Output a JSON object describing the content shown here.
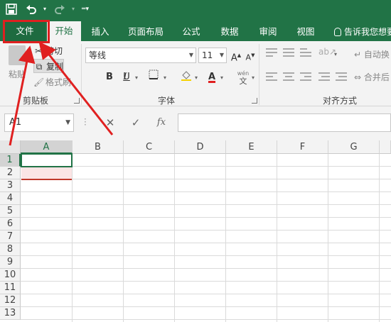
{
  "quick_access": {
    "save_icon": "save-icon",
    "undo_icon": "undo-icon",
    "redo_icon": "redo-icon",
    "customize_icon": "dropdown-icon"
  },
  "tabs": [
    {
      "label": "文件",
      "active": false
    },
    {
      "label": "开始",
      "active": true
    },
    {
      "label": "插入",
      "active": false
    },
    {
      "label": "页面布局",
      "active": false
    },
    {
      "label": "公式",
      "active": false
    },
    {
      "label": "数据",
      "active": false
    },
    {
      "label": "审阅",
      "active": false
    },
    {
      "label": "视图",
      "active": false
    }
  ],
  "tell_me": "告诉我您想要",
  "clipboard": {
    "paste_label": "粘贴",
    "cut_label": "剪切",
    "copy_label": "复制",
    "painter_label": "格式刷",
    "group_label": "剪贴板"
  },
  "font": {
    "name": "等线",
    "size": "11",
    "bold": "B",
    "italic": "I",
    "underline": "U",
    "font_color_letter": "A",
    "font_color": "#e02020",
    "wen_label": "wén",
    "wen_char": "文",
    "group_label": "字体"
  },
  "alignment": {
    "wrap_label": "自动换",
    "merge_label": "合并后",
    "group_label": "对齐方式"
  },
  "formula_bar": {
    "name_box": "A1",
    "cancel": "✕",
    "enter": "✓",
    "fx": "fx",
    "value": ""
  },
  "grid": {
    "columns": [
      "A",
      "B",
      "C",
      "D",
      "E",
      "F",
      "G"
    ],
    "rows": [
      "1",
      "2",
      "3",
      "4",
      "5",
      "6",
      "7",
      "8",
      "9",
      "10",
      "11",
      "12",
      "13"
    ],
    "active_cell": "A1"
  },
  "colors": {
    "accent": "#217346",
    "annotation": "#e02020"
  }
}
